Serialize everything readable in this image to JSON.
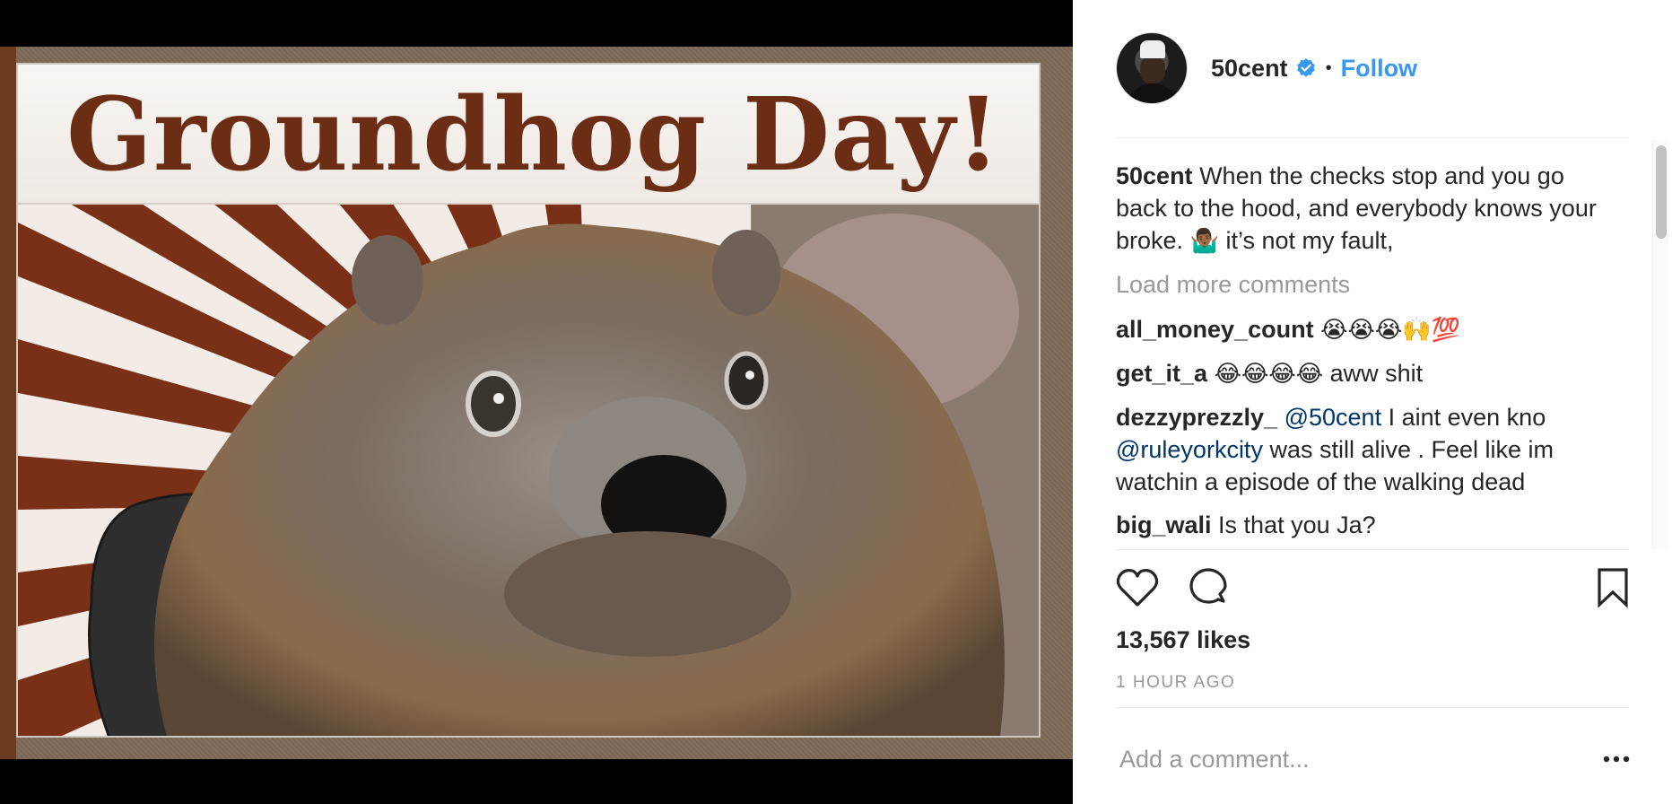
{
  "post_image": {
    "title_text": "Groundhog Day!",
    "colors": {
      "frame": "#7d6a56",
      "title": "#6b2d14",
      "ray": "#7a3016",
      "ray_bg": "#f3ece6"
    }
  },
  "header": {
    "username": "50cent",
    "separator": "•",
    "follow_label": "Follow"
  },
  "caption": {
    "user": "50cent",
    "text": "When the checks stop and you go back to the hood, and everybody knows your broke.",
    "emoji": "🤷🏾‍♂️",
    "text_end": "it’s not my fault,"
  },
  "load_more_label": "Load more comments",
  "comments": [
    {
      "user": "all_money_count",
      "text": "😭😭😭🙌💯"
    },
    {
      "user": "get_it_a",
      "emoji": "😂😂😂😂",
      "text": "aww shit"
    },
    {
      "user": "dezzyprezzly_",
      "mention1": "@50cent",
      "text1": "I aint even kno",
      "mention2": "@ruleyorkcity",
      "text2": "was still alive . Feel like im watchin a episode of the walking dead"
    },
    {
      "user": "big_wali",
      "text": "Is that you Ja?"
    }
  ],
  "likes_text": "13,567 likes",
  "timestamp": "1 HOUR AGO",
  "add_comment_placeholder": "Add a comment...",
  "icons": [
    "heart-icon",
    "comment-icon",
    "bookmark-icon",
    "more-options-icon",
    "verified-badge-icon"
  ],
  "colors": {
    "link": "#3897f0",
    "mention": "#003569",
    "muted": "#999999",
    "text": "#262626"
  }
}
